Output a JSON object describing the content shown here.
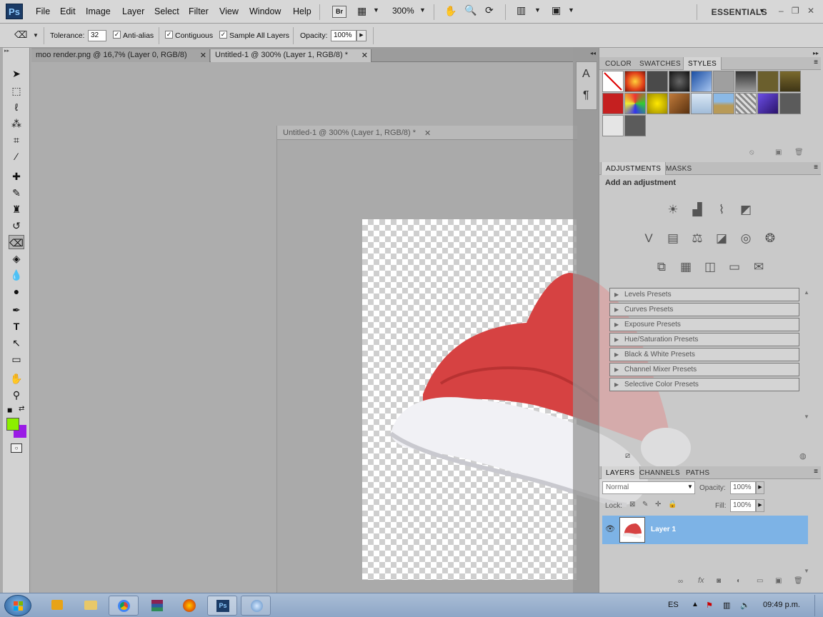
{
  "menubar": {
    "logo": "Ps",
    "items": [
      "File",
      "Edit",
      "Image",
      "Layer",
      "Select",
      "Filter",
      "View",
      "Window",
      "Help"
    ],
    "bridge": "Br",
    "zoom": "300%",
    "workspace": "ESSENTIALS"
  },
  "options": {
    "tolerance_label": "Tolerance:",
    "tolerance_value": "32",
    "antialias": "Anti-alias",
    "contiguous": "Contiguous",
    "sample_all": "Sample All Layers",
    "opacity_label": "Opacity:",
    "opacity_value": "100%"
  },
  "tabs": [
    {
      "label": "moo render.png @ 16,7% (Layer 0, RGB/8)"
    },
    {
      "label": "Untitled-1 @ 300% (Layer 1, RGB/8) *"
    }
  ],
  "floating_window": {
    "title": "Untitled-1 @ 300% (Layer 1, RGB/8) *"
  },
  "tools": [
    "move-tool-icon",
    "marquee-tool-icon",
    "lasso-tool-icon",
    "magic-wand-icon",
    "crop-tool-icon",
    "eyedropper-icon",
    "healing-brush-icon",
    "brush-tool-icon",
    "clone-stamp-icon",
    "history-brush-icon",
    "eraser-tool-icon",
    "paint-bucket-icon",
    "blur-tool-icon",
    "dodge-tool-icon",
    "pen-tool-icon",
    "type-tool-icon",
    "path-select-icon",
    "shape-tool-icon",
    "hand-tool-icon",
    "zoom-tool-icon"
  ],
  "colors": {
    "foreground": "#8cf000",
    "background": "#9a1be6"
  },
  "styles_panel": {
    "tabs": [
      "COLOR",
      "SWATCHES",
      "STYLES"
    ]
  },
  "adjustments_panel": {
    "tabs": [
      "ADJUSTMENTS",
      "MASKS"
    ],
    "heading": "Add an adjustment",
    "presets": [
      "Levels Presets",
      "Curves Presets",
      "Exposure Presets",
      "Hue/Saturation Presets",
      "Black & White Presets",
      "Channel Mixer Presets",
      "Selective Color Presets"
    ]
  },
  "layers_panel": {
    "tabs": [
      "LAYERS",
      "CHANNELS",
      "PATHS"
    ],
    "blend_mode": "Normal",
    "opacity_label": "Opacity:",
    "opacity_value": "100%",
    "lock_label": "Lock:",
    "fill_label": "Fill:",
    "fill_value": "100%",
    "layer_name": "Layer 1"
  },
  "taskbar": {
    "lang": "ES",
    "time": "09:49 p.m."
  }
}
